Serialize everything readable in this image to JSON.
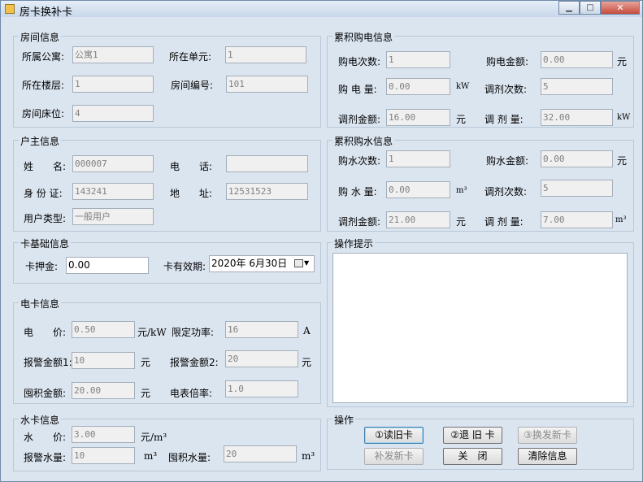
{
  "window": {
    "title": "房卡换补卡",
    "min_glyph": "▁",
    "max_glyph": "□",
    "close_glyph": "✕"
  },
  "room": {
    "title": "房间信息",
    "apartment_label": "所属公寓:",
    "apartment": "公寓1",
    "unit_label": "所在单元:",
    "unit": "1",
    "floor_label": "所在楼层:",
    "floor": "1",
    "room_no_label": "房间编号:",
    "room_no": "101",
    "bed_label": "房间床位:",
    "bed": "4"
  },
  "owner": {
    "title": "户主信息",
    "name_label": "姓　　名:",
    "name": "000007",
    "phone_label": "电　　话:",
    "phone": "",
    "id_label": "身 份 证:",
    "id": "143241",
    "addr_label": "地　　址:",
    "addr": "12531523",
    "type_label": "用户类型:",
    "type": "一般用户"
  },
  "card": {
    "title": "卡基础信息",
    "deposit_label": "卡押金:",
    "deposit": "0.00",
    "expiry_label": "卡有效期:",
    "expiry": "2020年 6月30日"
  },
  "elec": {
    "title": "电卡信息",
    "price_label": "电　　价:",
    "price": "0.50",
    "price_unit": "元/kW",
    "power_label": "限定功率:",
    "power": "16",
    "power_unit": "A",
    "alarm_label": "报警金额1:",
    "alarm": "10",
    "alarm_unit": "元",
    "alarm2_label": "报警金额2:",
    "alarm2": "20",
    "alarm2_unit": "元",
    "hoard_label": "囤积金额:",
    "hoard": "20.00",
    "hoard_unit": "元",
    "ratio_label": "电表倍率:",
    "ratio": "1.0"
  },
  "water": {
    "title": "水卡信息",
    "price_label": "水　　价:",
    "price": "3.00",
    "price_unit": "元/m³",
    "alarm_label": "报警水量:",
    "alarm": "10",
    "alarm_unit": "m³",
    "hoard_label": "囤积水量:",
    "hoard": "20",
    "hoard_unit": "m³"
  },
  "elec_total": {
    "title": "累积购电信息",
    "count_label": "购电次数:",
    "count": "1",
    "amount_label": "购电金额:",
    "amount": "0.00",
    "amount_unit": "元",
    "qty_label": "购 电 量:",
    "qty": "0.00",
    "qty_unit": "kW",
    "adj_count_label": "调剂次数:",
    "adj_count": "5",
    "adj_amount_label": "调剂金额:",
    "adj_amount": "16.00",
    "adj_amount_unit": "元",
    "adj_qty_label": "调 剂 量:",
    "adj_qty": "32.00",
    "adj_qty_unit": "kW"
  },
  "water_total": {
    "title": "累积购水信息",
    "count_label": "购水次数:",
    "count": "1",
    "amount_label": "购水金额:",
    "amount": "0.00",
    "amount_unit": "元",
    "qty_label": "购 水 量:",
    "qty": "0.00",
    "qty_unit": "m³",
    "adj_count_label": "调剂次数:",
    "adj_count": "5",
    "adj_amount_label": "调剂金额:",
    "adj_amount": "21.00",
    "adj_amount_unit": "元",
    "adj_qty_label": "调 剂 量:",
    "adj_qty": "7.00",
    "adj_qty_unit": "m³"
  },
  "hint": {
    "title": "操作提示",
    "text": ""
  },
  "ops": {
    "title": "操作",
    "read_old": "①读旧卡",
    "return_old": "②退 旧 卡",
    "issue_new": "③换发新卡",
    "reissue": "补发新卡",
    "close": "关　闭",
    "clear": "清除信息"
  },
  "colors": {
    "window_bg": "#dbe5f0",
    "group_border": "#b9c7d7",
    "disabled_text": "#808080"
  }
}
